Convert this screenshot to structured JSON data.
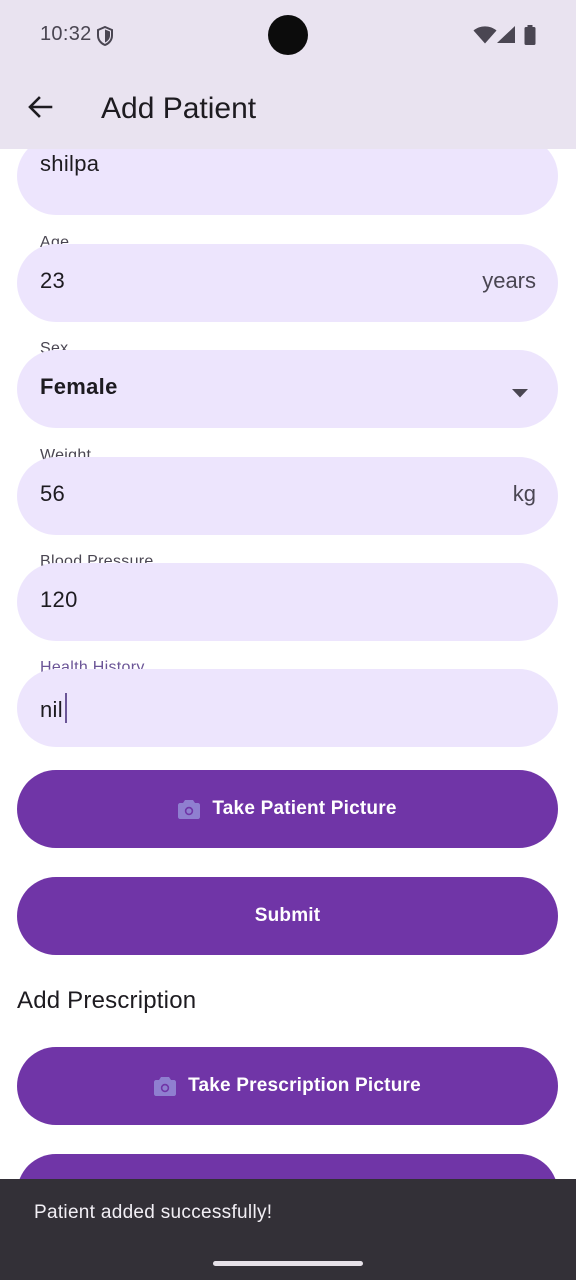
{
  "status_bar": {
    "time": "10:32"
  },
  "app_bar": {
    "title": "Add Patient"
  },
  "form": {
    "name": {
      "value": "shilpa"
    },
    "age": {
      "label": "Age",
      "value": "23",
      "suffix": "years"
    },
    "sex": {
      "label": "Sex",
      "value": "Female"
    },
    "weight": {
      "label": "Weight",
      "value": "56",
      "suffix": "kg"
    },
    "blood_pressure": {
      "label": "Blood Pressure",
      "value": "120"
    },
    "health_history": {
      "label": "Health History",
      "value": "nil"
    }
  },
  "buttons": {
    "take_patient_picture": "Take Patient Picture",
    "submit": "Submit",
    "take_prescription_picture": "Take Prescription Picture"
  },
  "prescription": {
    "title": "Add Prescription"
  },
  "snackbar": {
    "message": "Patient added successfully!"
  },
  "colors": {
    "primary": "#7035a7",
    "field_fill": "#ede5fd",
    "app_bar": "#e9e3f0",
    "snackbar": "#333037"
  },
  "icons": {
    "back": "arrow-left-icon",
    "camera": "camera-icon",
    "dropdown": "caret-down-icon"
  }
}
